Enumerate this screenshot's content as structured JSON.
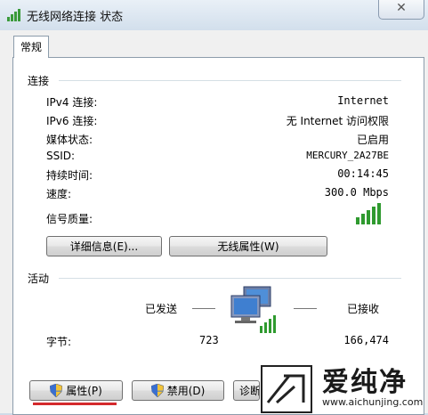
{
  "window": {
    "title": "无线网络连接 状态",
    "close_glyph": "✕"
  },
  "tab": {
    "label": "常规"
  },
  "connection": {
    "heading": "连接",
    "rows": [
      {
        "label": "IPv4 连接:",
        "value": "Internet"
      },
      {
        "label": "IPv6 连接:",
        "value": "无 Internet 访问权限"
      },
      {
        "label": "媒体状态:",
        "value": "已启用"
      },
      {
        "label": "SSID:",
        "value": "MERCURY_2A27BE"
      },
      {
        "label": "持续时间:",
        "value": "00:14:45"
      },
      {
        "label": "速度:",
        "value": "300.0 Mbps"
      }
    ],
    "signal_label": "信号质量:",
    "signal_bars": 5,
    "details_button": "详细信息(E)...",
    "wireless_props_button": "无线属性(W)"
  },
  "activity": {
    "heading": "活动",
    "sent_label": "已发送",
    "received_label": "已接收",
    "bytes_label": "字节:",
    "bytes_sent": "723",
    "bytes_received": "166,474"
  },
  "buttons": {
    "properties": "属性(P)",
    "disable": "禁用(D)",
    "diagnose": "诊断(G)"
  },
  "watermark": {
    "brand": "爱纯净",
    "url": "www.aichunjing.com"
  },
  "colors": {
    "signal_green": "#2f9a2f",
    "highlight_red": "#d4292c"
  }
}
